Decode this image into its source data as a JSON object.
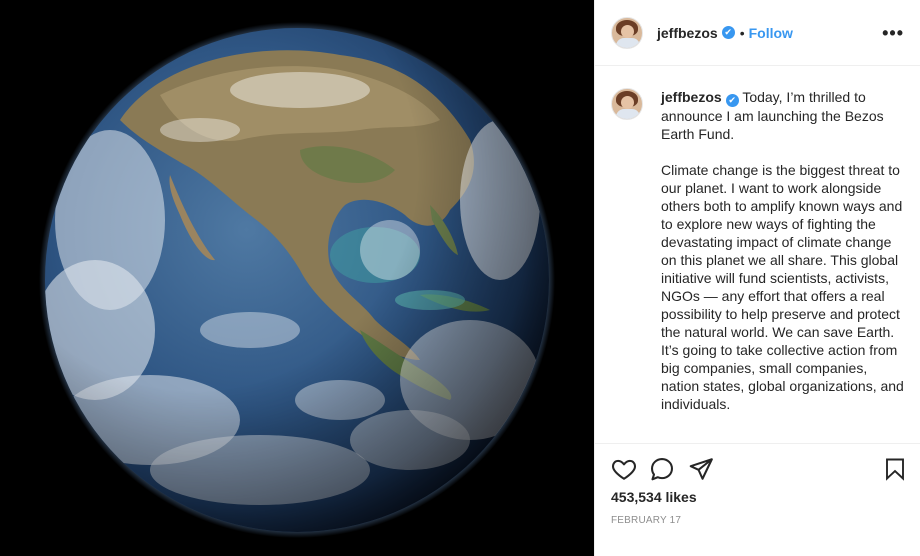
{
  "post": {
    "username": "jeffbezos",
    "follow_label": "Follow",
    "separator": "•",
    "more_label": "•••",
    "caption_intro": "Today, I’m thrilled to announce I am launching the Bezos Earth Fund.",
    "caption_body": "Climate change is the biggest threat to our planet. I want to work alongside others both to amplify known ways and to explore new ways of fighting the devastating impact of climate change on this planet we all share. This global initiative will fund scientists, activists, NGOs — any effort that offers a real possibility to help preserve and protect the natural world. We can save Earth. It’s going to take collective action from big companies, small companies, nation states, global organizations, and individuals.",
    "likes": "453,534 likes",
    "date": "FEBRUARY 17",
    "verified_icon": "✔"
  },
  "icons": {
    "like": "heart-icon",
    "comment": "comment-icon",
    "share": "share-icon",
    "save": "bookmark-icon"
  },
  "colors": {
    "link_blue": "#3897f0",
    "text": "#262626",
    "muted": "#8e8e8e",
    "border": "#efefef"
  }
}
